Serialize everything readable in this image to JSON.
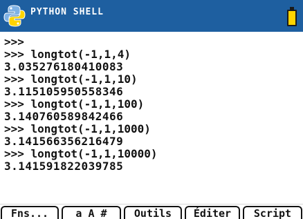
{
  "header": {
    "title": "PYTHON SHELL",
    "icons": {
      "logo": "python-logo-icon",
      "battery": "battery-icon"
    },
    "colors": {
      "bar": "#1e5fa0",
      "battery": "#ffd400"
    }
  },
  "console": {
    "lines": [
      ">>>",
      ">>> longtot(-1,1,4)",
      "3.035276180410083",
      ">>> longtot(-1,1,10)",
      "3.115105950558346",
      ">>> longtot(-1,1,100)",
      "3.140760589842466",
      ">>> longtot(-1,1,1000)",
      "3.141566356216479",
      ">>> longtot(-1,1,10000)",
      "3.141591822039785"
    ]
  },
  "menu": {
    "items": [
      "Fns...",
      "a A #",
      "Outils",
      "Éditer",
      "Script"
    ]
  }
}
